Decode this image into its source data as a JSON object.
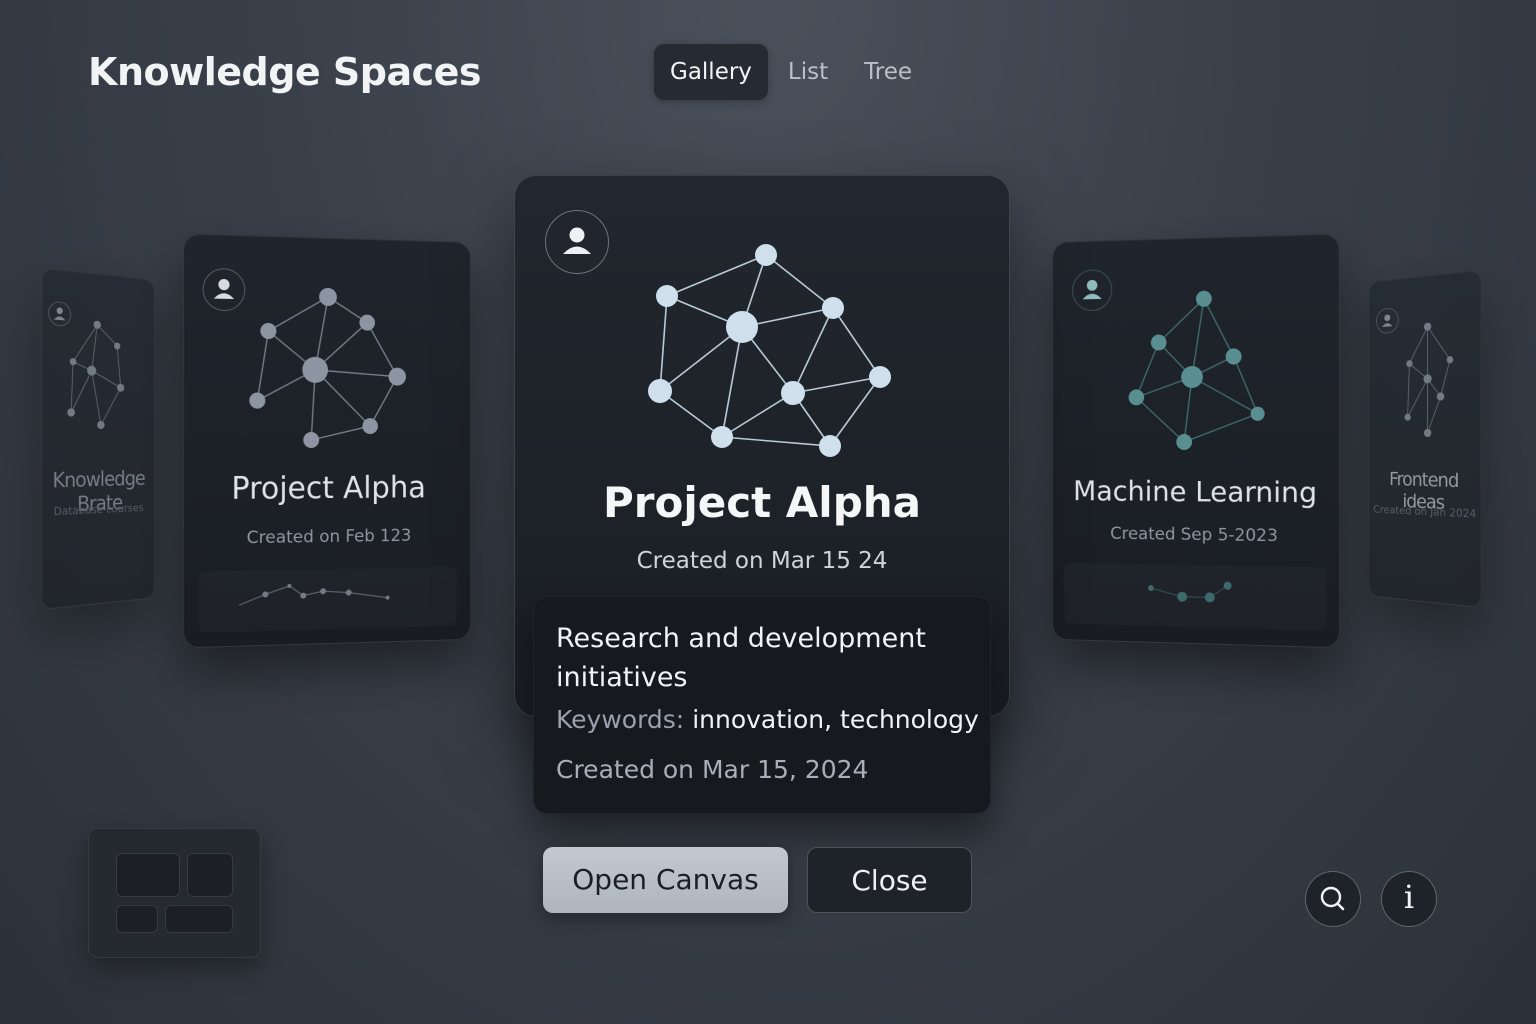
{
  "header": {
    "title": "Knowledge Spaces",
    "view_tabs": [
      {
        "label": "Gallery",
        "active": true
      },
      {
        "label": "List",
        "active": false
      },
      {
        "label": "Tree",
        "active": false
      }
    ]
  },
  "carousel": {
    "cards": [
      {
        "id": "far-left",
        "title": "Knowledge Brate",
        "date": "Database courses",
        "icon": "user-icon",
        "accent": "#9aa2ad"
      },
      {
        "id": "left",
        "title": "Project Alpha",
        "date": "Created on Feb 123",
        "icon": "user-icon",
        "accent": "#8d95a3"
      },
      {
        "id": "center",
        "title": "Project Alpha",
        "date": "Created on Mar 15 24",
        "icon": "user-icon",
        "accent": "#cfe0ec"
      },
      {
        "id": "right",
        "title": "Machine Learning",
        "date": "Created Sep 5-2023",
        "icon": "user-icon",
        "accent": "#5a8f92"
      },
      {
        "id": "far-right",
        "title": "Frontend ideas",
        "date": "Created on Jan 2024",
        "icon": "user-icon",
        "accent": "#9aa2ad"
      }
    ]
  },
  "detail": {
    "description": "Research and development initiatives",
    "keywords_label": "Keywords:",
    "keywords": "innovation, technology",
    "created": "Created on Mar 15, 2024"
  },
  "actions": {
    "open_label": "Open Canvas",
    "close_label": "Close"
  },
  "toolbar": {
    "layout_icon": "grid-layout-icon",
    "search_icon": "search-icon",
    "info_icon": "info-icon",
    "info_glyph": "i"
  },
  "colors": {
    "background": "#3a404a",
    "card": "#1d2128",
    "primary_button": "#b8bfc7",
    "graph_center": "#cfe0ec",
    "graph_ml": "#5a8f92"
  }
}
